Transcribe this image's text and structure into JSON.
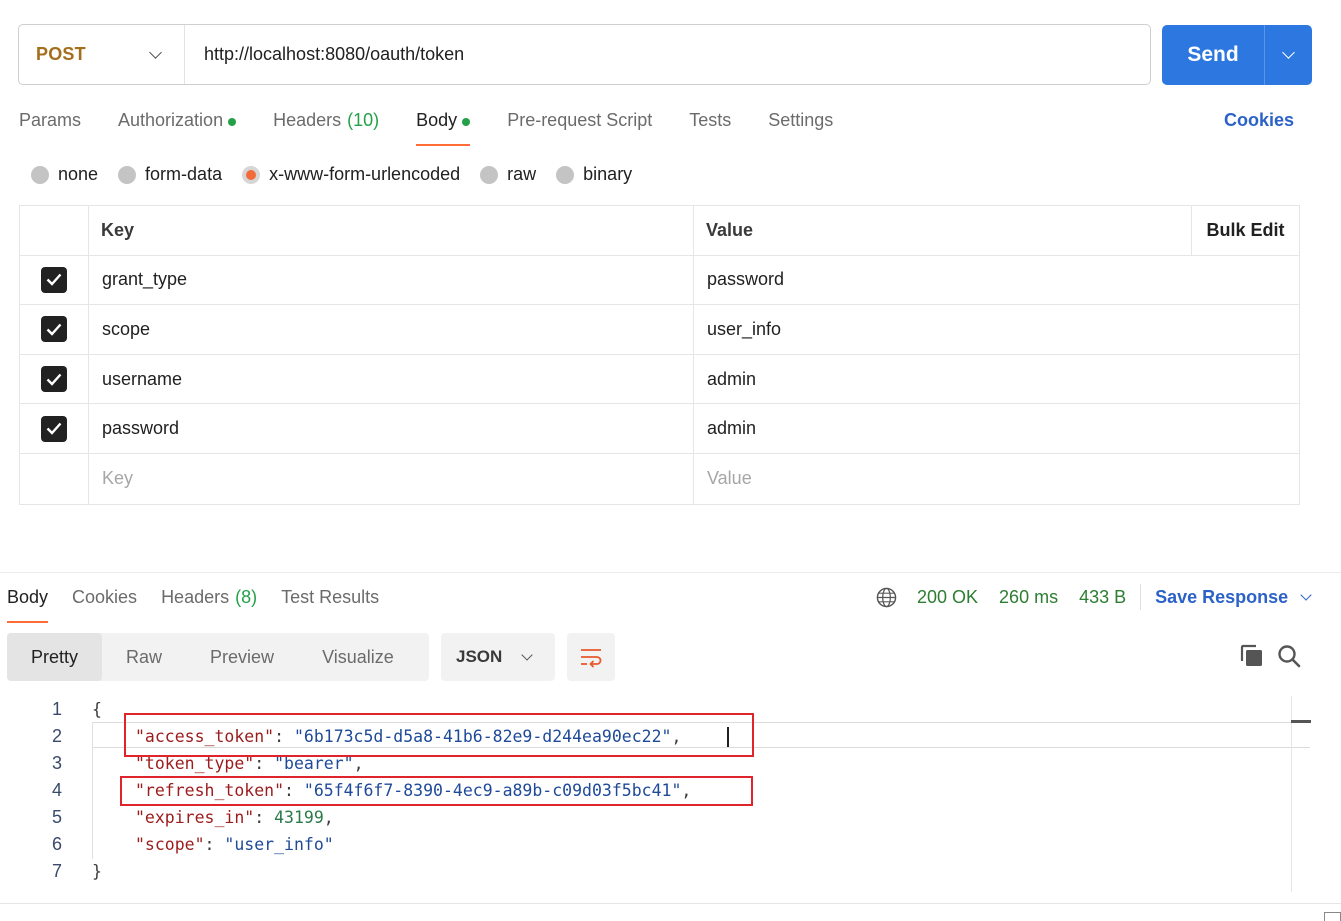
{
  "request": {
    "method": "POST",
    "url": "http://localhost:8080/oauth/token",
    "send_label": "Send"
  },
  "request_tabs": [
    {
      "label": "Params",
      "dot": false,
      "count": ""
    },
    {
      "label": "Authorization",
      "dot": true,
      "count": ""
    },
    {
      "label": "Headers",
      "dot": false,
      "count": "(10)"
    },
    {
      "label": "Body",
      "dot": true,
      "count": "",
      "active": true
    },
    {
      "label": "Pre-request Script",
      "dot": false,
      "count": ""
    },
    {
      "label": "Tests",
      "dot": false,
      "count": ""
    },
    {
      "label": "Settings",
      "dot": false,
      "count": ""
    }
  ],
  "cookies_label": "Cookies",
  "body_types": [
    {
      "label": "none",
      "selected": false
    },
    {
      "label": "form-data",
      "selected": false
    },
    {
      "label": "x-www-form-urlencoded",
      "selected": true
    },
    {
      "label": "raw",
      "selected": false
    },
    {
      "label": "binary",
      "selected": false
    }
  ],
  "kv_table": {
    "key_header": "Key",
    "value_header": "Value",
    "bulk_edit_label": "Bulk Edit",
    "rows": [
      {
        "key": "grant_type",
        "value": "password",
        "checked": true
      },
      {
        "key": "scope",
        "value": "user_info",
        "checked": true
      },
      {
        "key": "username",
        "value": "admin",
        "checked": true
      },
      {
        "key": "password",
        "value": "admin",
        "checked": true
      }
    ],
    "new_key_placeholder": "Key",
    "new_value_placeholder": "Value"
  },
  "response_tabs": [
    {
      "label": "Body",
      "count": "",
      "active": true
    },
    {
      "label": "Cookies",
      "count": ""
    },
    {
      "label": "Headers",
      "count": "(8)"
    },
    {
      "label": "Test Results",
      "count": ""
    }
  ],
  "response_stats": {
    "status": "200 OK",
    "time": "260 ms",
    "size": "433 B",
    "save_label": "Save Response"
  },
  "view_modes": [
    {
      "label": "Pretty",
      "active": true
    },
    {
      "label": "Raw",
      "active": false
    },
    {
      "label": "Preview",
      "active": false
    },
    {
      "label": "Visualize",
      "active": false
    }
  ],
  "format": "JSON",
  "icons": {
    "method_dropdown": "chevron-down-icon",
    "send_dropdown": "chevron-down-icon",
    "globe": "globe-icon",
    "wrap": "wrap-lines-icon",
    "copy": "copy-icon",
    "search": "search-icon"
  },
  "colors": {
    "send": "#2c78e0",
    "method": "#a46f1b",
    "accent": "#ff6c37",
    "status_green": "#2e7d32",
    "link": "#2c62c8",
    "highlight_box": "#e0242b"
  },
  "response_json": {
    "open_brace": "{",
    "close_brace": "}",
    "lines": [
      {
        "num": "1"
      },
      {
        "num": "2",
        "key": "\"access_token\"",
        "sep": ": ",
        "value": "\"6b173c5d-d5a8-41b6-82e9-d244ea90ec22\"",
        "type": "s",
        "trail": ","
      },
      {
        "num": "3",
        "key": "\"token_type\"",
        "sep": ": ",
        "value": "\"bearer\"",
        "type": "s",
        "trail": ","
      },
      {
        "num": "4",
        "key": "\"refresh_token\"",
        "sep": ": ",
        "value": "\"65f4f6f7-8390-4ec9-a89b-c09d03f5bc41\"",
        "type": "s",
        "trail": ","
      },
      {
        "num": "5",
        "key": "\"expires_in\"",
        "sep": ": ",
        "value": "43199",
        "type": "n",
        "trail": ","
      },
      {
        "num": "6",
        "key": "\"scope\"",
        "sep": ": ",
        "value": "\"user_info\"",
        "type": "s",
        "trail": ""
      },
      {
        "num": "7"
      }
    ]
  }
}
